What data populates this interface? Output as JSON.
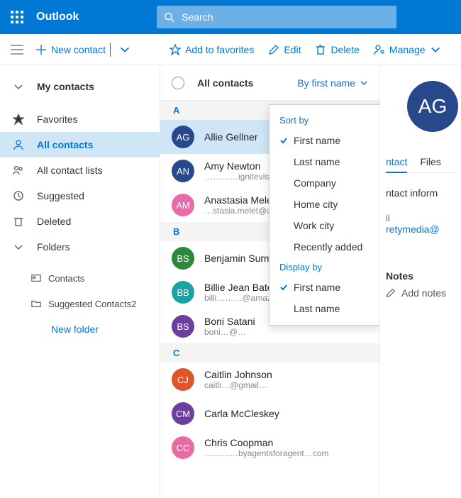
{
  "header": {
    "brand": "Outlook",
    "search_placeholder": "Search"
  },
  "toolbar": {
    "new_contact": "New contact",
    "add_favorites": "Add to favorites",
    "edit": "Edit",
    "delete": "Delete",
    "manage": "Manage"
  },
  "sidebar": {
    "my_contacts": "My contacts",
    "favorites": "Favorites",
    "all_contacts": "All contacts",
    "all_contact_lists": "All contact lists",
    "suggested": "Suggested",
    "deleted": "Deleted",
    "folders": "Folders",
    "sub_contacts": "Contacts",
    "sub_suggested": "Suggested Contacts2",
    "new_folder": "New folder"
  },
  "list": {
    "title": "All contacts",
    "sort_label": "By first name",
    "sections": [
      {
        "letter": "A",
        "contacts": [
          {
            "initials": "AG",
            "color": "#27488a",
            "name": "Allie Gellner",
            "email": "",
            "selected": true
          },
          {
            "initials": "AN",
            "color": "#27488a",
            "name": "Amy Newton",
            "email": "…………ignitevisibility.co"
          },
          {
            "initials": "AM",
            "color": "#e66ba7",
            "name": "Anastasia Melet",
            "email": "…stasia.melet@animatron…"
          }
        ]
      },
      {
        "letter": "B",
        "contacts": [
          {
            "initials": "BS",
            "color": "#2a8a3a",
            "name": "Benjamin Surman",
            "email": ""
          },
          {
            "initials": "BB",
            "color": "#1aa3a3",
            "name": "Billie Jean Bateson",
            "email": "billi………@amazingwrist…com"
          },
          {
            "initials": "BS",
            "color": "#6b3fa0",
            "name": "Boni Satani",
            "email": "boni…@…"
          }
        ]
      },
      {
        "letter": "C",
        "contacts": [
          {
            "initials": "CJ",
            "color": "#e0552b",
            "name": "Caitlin Johnson",
            "email": "caitli…@gmail…"
          },
          {
            "initials": "CM",
            "color": "#6b3fa0",
            "name": "Carla McCleskey",
            "email": ""
          },
          {
            "initials": "CC",
            "color": "#e66ba7",
            "name": "Chris Coopman",
            "email": "…………byagentsforagent…com"
          }
        ]
      }
    ]
  },
  "dropdown": {
    "sort_by_label": "Sort by",
    "sort_options": [
      "First name",
      "Last name",
      "Company",
      "Home city",
      "Work city",
      "Recently added"
    ],
    "sort_selected": 0,
    "display_by_label": "Display by",
    "display_options": [
      "First name",
      "Last name"
    ],
    "display_selected": 0
  },
  "details": {
    "avatar_initials": "AG",
    "tabs": {
      "contact": "ntact",
      "files": "Files"
    },
    "info_heading": "ntact inform",
    "email_label": "il",
    "email_fragment": "retymedia@",
    "notes_label": "Notes",
    "add_notes": "Add notes"
  }
}
